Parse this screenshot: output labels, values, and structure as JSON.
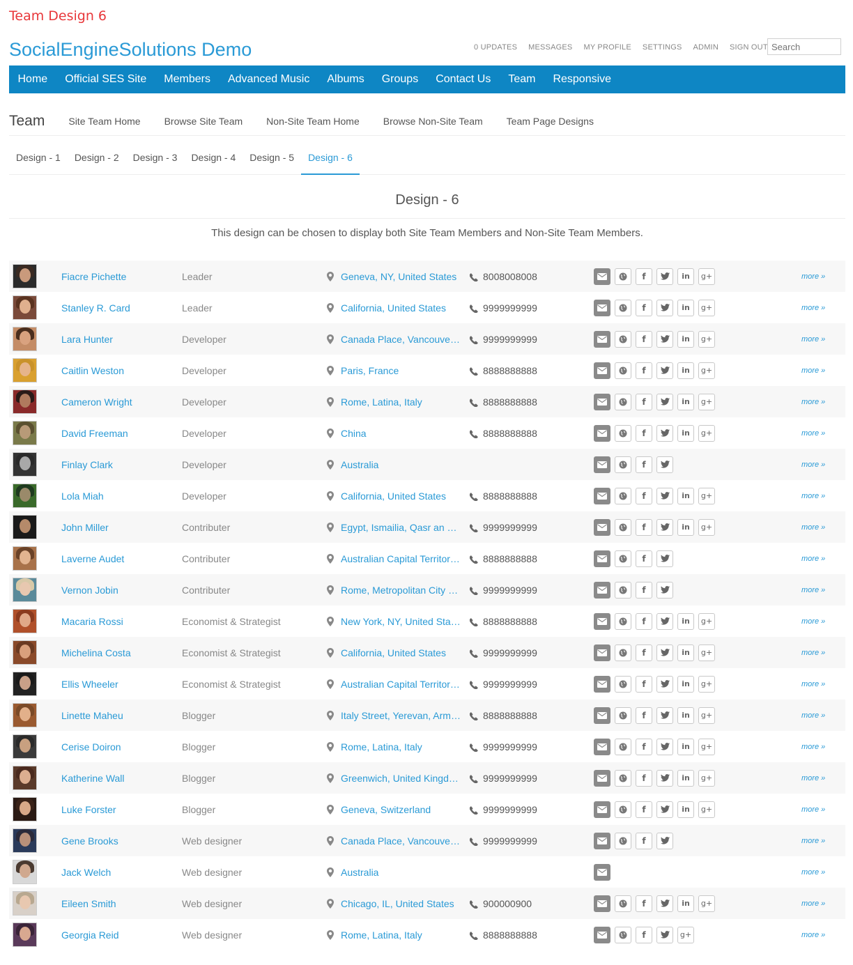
{
  "page_caption": "Team Design 6",
  "site_title": "SocialEngineSolutions Demo",
  "mini_menu": [
    "0 UPDATES",
    "MESSAGES",
    "MY PROFILE",
    "SETTINGS",
    "ADMIN",
    "SIGN OUT"
  ],
  "search": {
    "placeholder": "Search"
  },
  "main_nav": [
    "Home",
    "Official SES Site",
    "Members",
    "Advanced Music",
    "Albums",
    "Groups",
    "Contact Us",
    "Team",
    "Responsive"
  ],
  "sub_nav": {
    "title": "Team",
    "links": [
      "Site Team Home",
      "Browse Site Team",
      "Non-Site Team Home",
      "Browse Non-Site Team",
      "Team Page Designs"
    ]
  },
  "design_tabs": {
    "items": [
      "Design - 1",
      "Design - 2",
      "Design - 3",
      "Design - 4",
      "Design - 5",
      "Design - 6"
    ],
    "active": "Design - 6"
  },
  "design_heading": "Design - 6",
  "design_desc": "This design can be chosen to display both Site Team Members and Non-Site Team Members.",
  "more_label": "more »",
  "colors": {
    "accent": "#2a9ad6",
    "nav_bg": "#0e86c4",
    "caption": "#e8373a"
  },
  "members": [
    {
      "name": "Fiacre Pichette",
      "role": "Leader",
      "location": "Geneva, NY, United States",
      "phone": "8008008008",
      "socials": [
        "mail",
        "globe",
        "facebook",
        "twitter",
        "linkedin",
        "google-plus"
      ],
      "tone": [
        "#3a2a22",
        "#c99a7c",
        "#2b2b2b"
      ]
    },
    {
      "name": "Stanley R. Card",
      "role": "Leader",
      "location": "California, United States",
      "phone": "9999999999",
      "socials": [
        "mail",
        "globe",
        "facebook",
        "twitter",
        "linkedin",
        "google-plus"
      ],
      "tone": [
        "#5a3320",
        "#e0b08e",
        "#7a4a3a"
      ]
    },
    {
      "name": "Lara Hunter",
      "role": "Developer",
      "location": "Canada Place, Vancouver, BC, Canada",
      "phone": "9999999999",
      "socials": [
        "mail",
        "globe",
        "facebook",
        "twitter",
        "linkedin",
        "google-plus"
      ],
      "tone": [
        "#4a2e1e",
        "#d9a27f",
        "#c48c66"
      ]
    },
    {
      "name": "Caitlin Weston",
      "role": "Developer",
      "location": "Paris, France",
      "phone": "8888888888",
      "socials": [
        "mail",
        "globe",
        "facebook",
        "twitter",
        "linkedin",
        "google-plus"
      ],
      "tone": [
        "#c9922b",
        "#e6b48a",
        "#d9a030"
      ]
    },
    {
      "name": "Cameron Wright",
      "role": "Developer",
      "location": "Rome, Latina, Italy",
      "phone": "8888888888",
      "socials": [
        "mail",
        "globe",
        "facebook",
        "twitter",
        "linkedin",
        "google-plus"
      ],
      "tone": [
        "#2a1a18",
        "#b07a5e",
        "#8a2a2a"
      ]
    },
    {
      "name": "David Freeman",
      "role": "Developer",
      "location": "China",
      "phone": "8888888888",
      "socials": [
        "mail",
        "globe",
        "facebook",
        "twitter",
        "linkedin",
        "google-plus"
      ],
      "tone": [
        "#5a5030",
        "#b89a78",
        "#7a7a4a"
      ]
    },
    {
      "name": "Finlay Clark",
      "role": "Developer",
      "location": "Australia",
      "phone": "",
      "socials": [
        "mail",
        "globe",
        "facebook",
        "twitter"
      ],
      "tone": [
        "#2a2a2a",
        "#a8a8a8",
        "#333333"
      ]
    },
    {
      "name": "Lola Miah",
      "role": "Developer",
      "location": "California, United States",
      "phone": "8888888888",
      "socials": [
        "mail",
        "globe",
        "facebook",
        "twitter",
        "linkedin",
        "google-plus"
      ],
      "tone": [
        "#1f3a1f",
        "#9a8a6a",
        "#3a6a2a"
      ]
    },
    {
      "name": "John Miller",
      "role": "Contributer",
      "location": "Egypt, Ismailia, Qasr an Nile, Egypt",
      "phone": "9999999999",
      "socials": [
        "mail",
        "globe",
        "facebook",
        "twitter",
        "linkedin",
        "google-plus"
      ],
      "tone": [
        "#1a1a1a",
        "#b58a6a",
        "#1a1a1a"
      ]
    },
    {
      "name": "Laverne Audet",
      "role": "Contributer",
      "location": "Australian Capital Territory, Australia",
      "phone": "8888888888",
      "socials": [
        "mail",
        "globe",
        "facebook",
        "twitter"
      ],
      "tone": [
        "#6a4228",
        "#e2b490",
        "#a8724a"
      ]
    },
    {
      "name": "Vernon Jobin",
      "role": "Contributer",
      "location": "Rome, Metropolitan City of Rome, Italy",
      "phone": "9999999999",
      "socials": [
        "mail",
        "globe",
        "facebook",
        "twitter"
      ],
      "tone": [
        "#d8c9a8",
        "#e8c8b0",
        "#5a8a9a"
      ]
    },
    {
      "name": "Macaria Rossi",
      "role": "Economist & Strategist",
      "location": "New York, NY, United States",
      "phone": "8888888888",
      "socials": [
        "mail",
        "globe",
        "facebook",
        "twitter",
        "linkedin",
        "google-plus"
      ],
      "tone": [
        "#8a3a1e",
        "#e0a888",
        "#b0502a"
      ]
    },
    {
      "name": "Michelina Costa",
      "role": "Economist & Strategist",
      "location": "California, United States",
      "phone": "9999999999",
      "socials": [
        "mail",
        "globe",
        "facebook",
        "twitter",
        "linkedin",
        "google-plus"
      ],
      "tone": [
        "#6a3a22",
        "#d9a07c",
        "#8a4a2a"
      ]
    },
    {
      "name": "Ellis Wheeler",
      "role": "Economist & Strategist",
      "location": "Australian Capital Territory, Australia",
      "phone": "9999999999",
      "socials": [
        "mail",
        "globe",
        "facebook",
        "twitter",
        "linkedin",
        "google-plus"
      ],
      "tone": [
        "#1a1a1a",
        "#c8a088",
        "#222222"
      ]
    },
    {
      "name": "Linette Maheu",
      "role": "Blogger",
      "location": "Italy Street, Yerevan, Armenia",
      "phone": "8888888888",
      "socials": [
        "mail",
        "globe",
        "facebook",
        "twitter",
        "linkedin",
        "google-plus"
      ],
      "tone": [
        "#7a4a28",
        "#e2b08a",
        "#9a5a30"
      ]
    },
    {
      "name": "Cerise Doiron",
      "role": "Blogger",
      "location": "Rome, Latina, Italy",
      "phone": "9999999999",
      "socials": [
        "mail",
        "globe",
        "facebook",
        "twitter",
        "linkedin",
        "google-plus"
      ],
      "tone": [
        "#2a2a2a",
        "#c8a080",
        "#3a3a3a"
      ]
    },
    {
      "name": "Katherine Wall",
      "role": "Blogger",
      "location": "Greenwich, United Kingdom",
      "phone": "9999999999",
      "socials": [
        "mail",
        "globe",
        "facebook",
        "twitter",
        "linkedin",
        "google-plus"
      ],
      "tone": [
        "#4a2a1e",
        "#dcae90",
        "#5a3a2a"
      ]
    },
    {
      "name": "Luke Forster",
      "role": "Blogger",
      "location": "Geneva, Switzerland",
      "phone": "9999999999",
      "socials": [
        "mail",
        "globe",
        "facebook",
        "twitter",
        "linkedin",
        "google-plus"
      ],
      "tone": [
        "#3a2218",
        "#d8a888",
        "#2a1a14"
      ]
    },
    {
      "name": "Gene Brooks",
      "role": "Web designer",
      "location": "Canada Place, Vancouver, BC, Canada",
      "phone": "9999999999",
      "socials": [
        "mail",
        "globe",
        "facebook",
        "twitter"
      ],
      "tone": [
        "#2a2a3a",
        "#b8907a",
        "#2a3a5a"
      ]
    },
    {
      "name": "Jack Welch",
      "role": "Web designer",
      "location": "Australia",
      "phone": "",
      "socials": [
        "mail"
      ],
      "tone": [
        "#4a3a30",
        "#d0a88e",
        "#d8d8d8"
      ]
    },
    {
      "name": "Eileen Smith",
      "role": "Web designer",
      "location": "Chicago, IL, United States",
      "phone": "900000900",
      "socials": [
        "mail",
        "globe",
        "facebook",
        "twitter",
        "linkedin",
        "google-plus"
      ],
      "tone": [
        "#b8a890",
        "#e8c8b0",
        "#d8d0c8"
      ]
    },
    {
      "name": "Georgia Reid",
      "role": "Web designer",
      "location": "Rome, Latina, Italy",
      "phone": "8888888888",
      "socials": [
        "mail",
        "globe",
        "facebook",
        "twitter",
        "google-plus"
      ],
      "tone": [
        "#3a2438",
        "#d8a890",
        "#5a3a5a"
      ]
    }
  ]
}
